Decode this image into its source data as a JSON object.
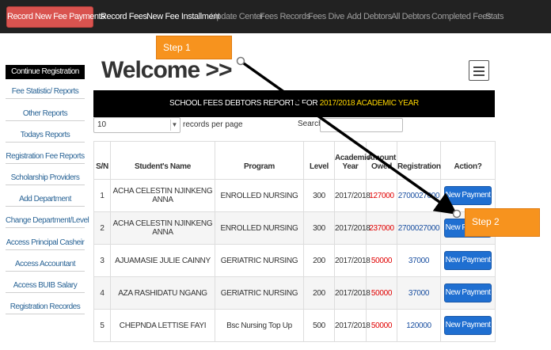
{
  "topnav": {
    "primary": "Record New Fee Payments",
    "items": [
      "Record Fees",
      "New Fee Installment",
      "Update Center",
      "Fees Records",
      "Fees Dive",
      "Add Debtors",
      "All Debtors",
      "Completed Fees",
      "Stats"
    ]
  },
  "sidebar": {
    "items": [
      "Continue Registration",
      "Fee Statistic/ Reports",
      "Other Reports",
      "Todays Reports",
      "Registration Fee Reports",
      "Scholarship Providers",
      "Add Department",
      "Change Department/Level",
      "Access Principal Casheir",
      "Access Accountant",
      "Access BUIB Salary",
      "Registration Recordes"
    ]
  },
  "main": {
    "welcome": "Welcome >>",
    "banner_prefix": "SCHOOL FEES DEBTORS REPORTS FOR ",
    "banner_year": "2017/2018 ACADEMIC YEAR",
    "records_value": "10",
    "records_label": "records per page",
    "search_label": "Search:"
  },
  "table": {
    "headers": [
      "S/N",
      "Student's Name",
      "Program",
      "Level",
      "Academic Year",
      "Amount Owed",
      "Registration",
      "Action?"
    ],
    "rows": [
      {
        "sn": "1",
        "name": "ACHA CELESTIN NJINKENG ANNA",
        "program": "ENROLLED NURSING",
        "level": "300",
        "year": "2017/2018",
        "owed": "127000",
        "registration": "2700027000",
        "action": "New Payment"
      },
      {
        "sn": "2",
        "name": "ACHA CELESTIN NJINKENG ANNA",
        "program": "ENROLLED NURSING",
        "level": "300",
        "year": "2017/2018",
        "owed": "237000",
        "registration": "2700027000",
        "action": "New Payment"
      },
      {
        "sn": "3",
        "name": "AJUAMASIE JULIE CAINNY",
        "program": "GERIATRIC NURSING",
        "level": "200",
        "year": "2017/2018",
        "owed": "50000",
        "registration": "37000",
        "action": "New Payment"
      },
      {
        "sn": "4",
        "name": "AZA RASHIDATU NGANG",
        "program": "GERIATRIC NURSING",
        "level": "200",
        "year": "2017/2018",
        "owed": "50000",
        "registration": "37000",
        "action": "New Payment"
      },
      {
        "sn": "5",
        "name": "CHEPNDA LETTISE FAYI",
        "program": "Bsc Nursing Top Up",
        "level": "500",
        "year": "2017/2018",
        "owed": "50000",
        "registration": "120000",
        "action": "New Payment"
      }
    ]
  },
  "callouts": {
    "step1": "Step 1",
    "step2": "Step 2"
  },
  "colors": {
    "primary_nav": "#d9534f",
    "banner_year": "#ffd700",
    "amount_owed": "#e00000",
    "new_payment_button": "#1f6fd1",
    "callout": "#f7931e"
  }
}
